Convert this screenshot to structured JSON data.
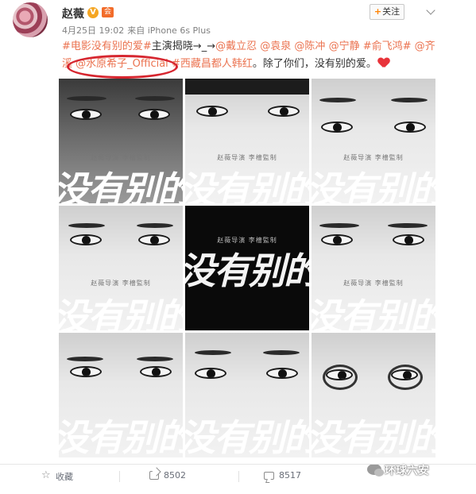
{
  "header": {
    "username": "赵薇",
    "vip_badge": "V",
    "member_badge": "会",
    "date": "4月25日 19:02",
    "source": "来自 iPhone 6s Plus",
    "follow_label": "关注",
    "follow_plus": "+"
  },
  "post": {
    "line1": [
      {
        "type": "link",
        "text": "#电影没有别的爱#"
      },
      {
        "type": "text",
        "text": "主演揭晓→_→"
      },
      {
        "type": "link",
        "text": "@戴立忍"
      },
      {
        "type": "text",
        "text": " "
      },
      {
        "type": "link",
        "text": "@袁泉"
      },
      {
        "type": "text",
        "text": " "
      },
      {
        "type": "link",
        "text": "@陈冲"
      },
      {
        "type": "text",
        "text": " "
      },
      {
        "type": "link",
        "text": "@宁静"
      },
      {
        "type": "text",
        "text": " "
      },
      {
        "type": "link",
        "text": "#俞飞鸿#"
      },
      {
        "type": "text",
        "text": " "
      },
      {
        "type": "link",
        "text": "@齐"
      }
    ],
    "line2": [
      {
        "type": "link",
        "text": "溪"
      },
      {
        "type": "text",
        "text": " "
      },
      {
        "type": "link",
        "text": "@水原希子_Official"
      },
      {
        "type": "text",
        "text": " "
      },
      {
        "type": "link",
        "text": "#西藏昌都人韩红"
      },
      {
        "type": "text",
        "text": "。除了你们，没有别的爱。"
      }
    ]
  },
  "grid": {
    "credit": "赵薇导演 李檣監制",
    "slogan": "没有别的爱"
  },
  "watermark": {
    "text": "环球六安"
  },
  "footer": {
    "favorite_label": "收藏",
    "share_count": "8502",
    "comment_count": "8517"
  }
}
